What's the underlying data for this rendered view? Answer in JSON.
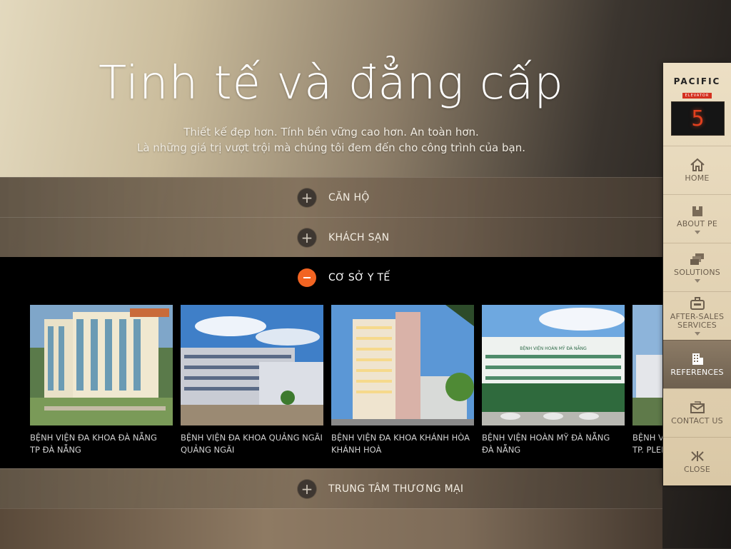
{
  "hero": {
    "title": "Tinh tế và đẳng cấp",
    "subtitle_line1": "Thiết kế đẹp hơn. Tính bền vững cao hơn. An toàn hơn.",
    "subtitle_line2": "Là những giá trị vượt trội mà chúng tôi đem đến cho công trình của bạn."
  },
  "accordion": {
    "items": [
      {
        "label": "CĂN HỘ",
        "icon": "plus-icon",
        "expanded": false
      },
      {
        "label": "KHÁCH SẠN",
        "icon": "plus-icon",
        "expanded": false
      },
      {
        "label": "CƠ SỞ Y TẾ",
        "icon": "minus-icon",
        "expanded": true
      },
      {
        "label": "TRUNG TÂM THƯƠNG MẠI",
        "icon": "plus-icon",
        "expanded": false
      }
    ],
    "gallery": [
      {
        "name": "BỆNH VIỆN ĐA KHOA ĐÀ NẴNG",
        "location": "TP ĐÀ NẴNG"
      },
      {
        "name": "BỆNH VIỆN ĐA KHOA QUẢNG NGÃI",
        "location": "QUẢNG NGÃI"
      },
      {
        "name": "BỆNH VIỆN ĐA KHOA KHÁNH HÒA",
        "location": "KHÁNH HOÀ"
      },
      {
        "name": "BỆNH VIỆN HOÀN MỸ ĐÀ NẴNG",
        "location": "ĐÀ NẴNG"
      },
      {
        "name": "BỆNH VIỆ",
        "location": "TP. PLEIK"
      }
    ],
    "photo_sign": "BỆNH VIỆN HOÀN MỸ ĐÀ NẴNG"
  },
  "sidebar": {
    "logo": "PACIFIC",
    "logo_sub": "ELEVATOR",
    "floor": "5",
    "items": [
      {
        "label": "HOME",
        "icon": "home-icon",
        "caret": false
      },
      {
        "label": "ABOUT PE",
        "icon": "building-block-icon",
        "caret": true
      },
      {
        "label": "SOLUTIONS",
        "icon": "stack-icon",
        "caret": true
      },
      {
        "label": "AFTER-SALES SERVICES",
        "icon": "toolbox-icon",
        "caret": true
      },
      {
        "label": "REFERENCES",
        "icon": "building-icon",
        "caret": false,
        "active": true
      },
      {
        "label": "CONTACT US",
        "icon": "mail-icon",
        "caret": false
      },
      {
        "label": "CLOSE",
        "icon": "close-arrows-icon",
        "caret": false
      }
    ]
  },
  "colors": {
    "accent": "#f26422",
    "floor_digit": "#e2401e",
    "sidebar_bg": "#e4d6b8",
    "sidebar_active": "#7d6e5b"
  }
}
